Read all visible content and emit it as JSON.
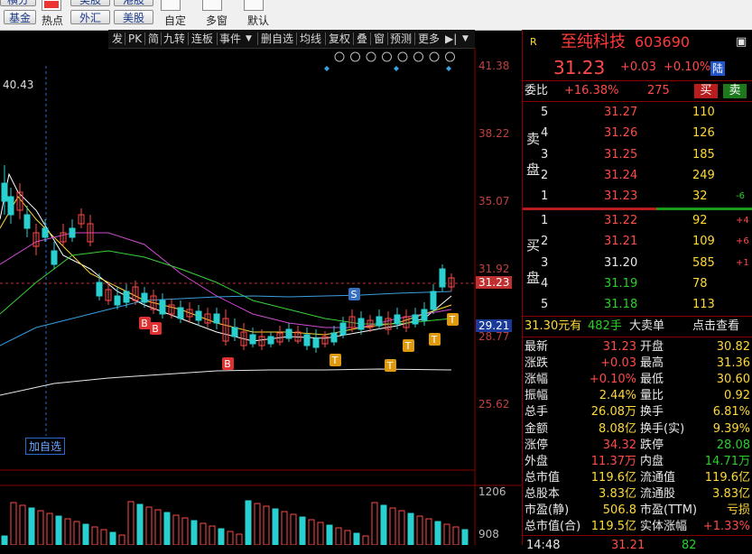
{
  "toolbar": {
    "top_row": [
      "横分",
      "美股",
      "港股"
    ],
    "buttons": [
      "基金",
      "外汇",
      "美股"
    ],
    "labels": [
      "热点",
      "自定",
      "多窗",
      "默认"
    ]
  },
  "chart_toolbar": {
    "items": [
      "发",
      "PK",
      "简",
      "九转",
      "连板",
      "事件",
      "删自选",
      "均线",
      "复权",
      "叠",
      "窗",
      "预测",
      "更多"
    ]
  },
  "chart": {
    "price_axis": [
      "41.38",
      "38.22",
      "35.07",
      "31.92",
      "28.77",
      "25.62"
    ],
    "current_price_tag": "31.23",
    "highlight_price_tag": "29.21",
    "volume_axis": [
      "1206",
      "908"
    ],
    "high_label": "40.43",
    "crosshair_label": "加自选",
    "signal_marks": [
      {
        "label": "B"
      },
      {
        "label": "B"
      },
      {
        "label": "B"
      },
      {
        "label": "S"
      },
      {
        "label": "T"
      },
      {
        "label": "T"
      },
      {
        "label": "T"
      },
      {
        "label": "T"
      },
      {
        "label": "T"
      }
    ]
  },
  "quote": {
    "name": "至纯科技",
    "code": "603690",
    "market_flag": "R",
    "price": "31.23",
    "change": "+0.03",
    "change_pct": "+0.10%",
    "tag": "陆",
    "weibi_label": "委比",
    "weibi_value": "+16.38%",
    "weicha_value": "275",
    "buy_btn": "买",
    "sell_btn": "卖",
    "sell_side_label": [
      "卖",
      "盘"
    ],
    "buy_side_label": [
      "买",
      "盘"
    ],
    "asks": [
      {
        "level": "5",
        "price": "31.27",
        "vol": "110",
        "chg": ""
      },
      {
        "level": "4",
        "price": "31.26",
        "vol": "126",
        "chg": ""
      },
      {
        "level": "3",
        "price": "31.25",
        "vol": "185",
        "chg": ""
      },
      {
        "level": "2",
        "price": "31.24",
        "vol": "249",
        "chg": ""
      },
      {
        "level": "1",
        "price": "31.23",
        "vol": "32",
        "chg": "-6"
      }
    ],
    "bids": [
      {
        "level": "1",
        "price": "31.22",
        "vol": "92",
        "chg": "+4"
      },
      {
        "level": "2",
        "price": "31.21",
        "vol": "109",
        "chg": "+6"
      },
      {
        "level": "3",
        "price": "31.20",
        "vol": "585",
        "chg": "+1"
      },
      {
        "level": "4",
        "price": "31.19",
        "vol": "78",
        "chg": ""
      },
      {
        "level": "5",
        "price": "31.18",
        "vol": "113",
        "chg": ""
      }
    ],
    "big_order": {
      "price": "31.30元有",
      "vol": "482手",
      "label": "大卖单",
      "link": "点击查看"
    },
    "stats": [
      [
        "最新",
        "31.23",
        "开盘",
        "30.82"
      ],
      [
        "涨跌",
        "+0.03",
        "最高",
        "31.36"
      ],
      [
        "涨幅",
        "+0.10%",
        "最低",
        "30.60"
      ],
      [
        "振幅",
        "2.44%",
        "量比",
        "0.92"
      ],
      [
        "总手",
        "26.08万",
        "换手",
        "6.81%"
      ],
      [
        "金额",
        "8.08亿",
        "换手(实)",
        "9.39%"
      ],
      [
        "涨停",
        "34.32",
        "跌停",
        "28.08"
      ],
      [
        "外盘",
        "11.37万",
        "内盘",
        "14.71万"
      ],
      [
        "总市值",
        "119.6亿",
        "流通值",
        "119.6亿"
      ],
      [
        "总股本",
        "3.83亿",
        "流通股",
        "3.83亿"
      ],
      [
        "市盈(静)",
        "506.8",
        "市盈(TTM)",
        "亏损"
      ],
      [
        "总市值(合)",
        "119.5亿",
        "实体涨幅",
        "+1.33%"
      ]
    ],
    "footer_row": {
      "time": "14:48",
      "price": "31.21",
      "vol": "82"
    }
  }
}
